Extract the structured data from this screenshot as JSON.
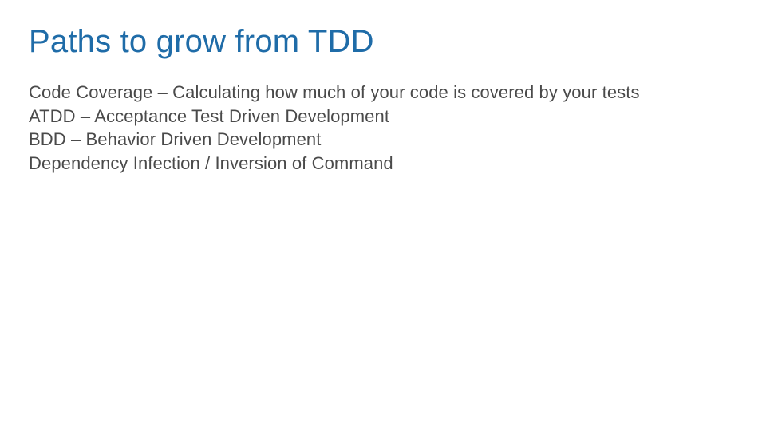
{
  "slide": {
    "title": "Paths to grow from TDD",
    "lines": [
      "Code Coverage – Calculating how much of your code is covered by your tests",
      "ATDD – Acceptance Test Driven Development",
      "BDD – Behavior Driven Development",
      "Dependency Infection / Inversion of Command"
    ]
  }
}
